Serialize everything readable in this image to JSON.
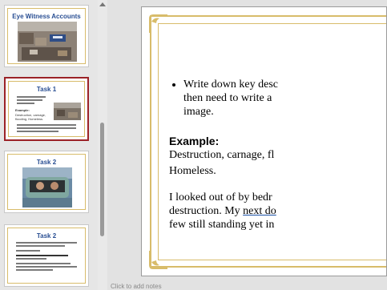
{
  "thumbnails": [
    {
      "title": "Eye Witness Accounts",
      "selected": false
    },
    {
      "title": "Task 1",
      "selected": true,
      "example_label": "Example:",
      "example_words": "Destruction, carnage, flooding, Homeless."
    },
    {
      "title": "Task 2",
      "selected": false
    },
    {
      "title": "Task 2",
      "selected": false
    }
  ],
  "slide": {
    "bullet_lines": [
      "Write down key desc",
      "then need to write a",
      "image."
    ],
    "example_heading": "Example:",
    "example_line1": "Destruction, carnage, fl",
    "example_line2": "Homeless.",
    "para_line1": "I looked out of by bedr",
    "para_line2_a": "destruction. My ",
    "para_line2_b": "next do",
    "para_line3": "few still standing yet in"
  },
  "notes_placeholder": "Click to add notes",
  "colors": {
    "accent": "#9b2227",
    "gold": "#d8bc6a",
    "title_blue": "#2a4f93"
  }
}
